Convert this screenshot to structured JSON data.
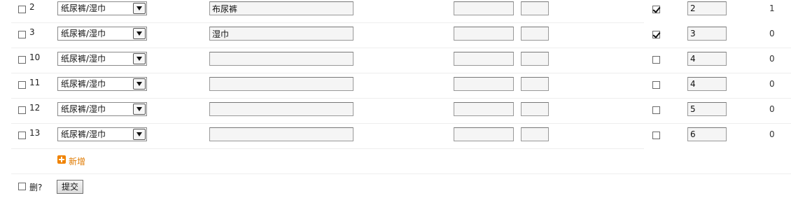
{
  "rows": [
    {
      "selected": false,
      "id": "2",
      "category": "纸尿裤/湿巾",
      "name": "布尿裤",
      "field_a": "",
      "field_b": "",
      "enabled": true,
      "order": "2",
      "count": "1"
    },
    {
      "selected": false,
      "id": "3",
      "category": "纸尿裤/湿巾",
      "name": "湿巾",
      "field_a": "",
      "field_b": "",
      "enabled": true,
      "order": "3",
      "count": "0"
    },
    {
      "selected": false,
      "id": "10",
      "category": "纸尿裤/湿巾",
      "name": "",
      "field_a": "",
      "field_b": "",
      "enabled": false,
      "order": "4",
      "count": "0"
    },
    {
      "selected": false,
      "id": "11",
      "category": "纸尿裤/湿巾",
      "name": "",
      "field_a": "",
      "field_b": "",
      "enabled": false,
      "order": "4",
      "count": "0"
    },
    {
      "selected": false,
      "id": "12",
      "category": "纸尿裤/湿巾",
      "name": "",
      "field_a": "",
      "field_b": "",
      "enabled": false,
      "order": "5",
      "count": "0"
    },
    {
      "selected": false,
      "id": "13",
      "category": "纸尿裤/湿巾",
      "name": "",
      "field_a": "",
      "field_b": "",
      "enabled": false,
      "order": "6",
      "count": "0"
    }
  ],
  "add_label": "新增",
  "delete_label": "删?",
  "submit_label": "提交",
  "colors": {
    "accent": "#f08300",
    "add_text": "#e07a00"
  }
}
